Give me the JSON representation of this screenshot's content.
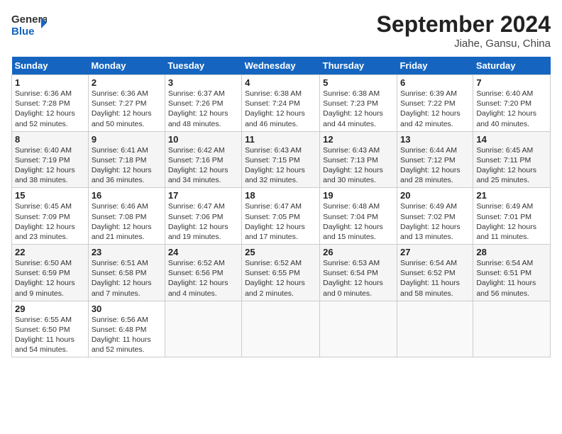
{
  "header": {
    "logo_general": "General",
    "logo_blue": "Blue",
    "month": "September 2024",
    "location": "Jiahe, Gansu, China"
  },
  "weekdays": [
    "Sunday",
    "Monday",
    "Tuesday",
    "Wednesday",
    "Thursday",
    "Friday",
    "Saturday"
  ],
  "weeks": [
    [
      {
        "day": "1",
        "info": "Sunrise: 6:36 AM\nSunset: 7:28 PM\nDaylight: 12 hours\nand 52 minutes."
      },
      {
        "day": "2",
        "info": "Sunrise: 6:36 AM\nSunset: 7:27 PM\nDaylight: 12 hours\nand 50 minutes."
      },
      {
        "day": "3",
        "info": "Sunrise: 6:37 AM\nSunset: 7:26 PM\nDaylight: 12 hours\nand 48 minutes."
      },
      {
        "day": "4",
        "info": "Sunrise: 6:38 AM\nSunset: 7:24 PM\nDaylight: 12 hours\nand 46 minutes."
      },
      {
        "day": "5",
        "info": "Sunrise: 6:38 AM\nSunset: 7:23 PM\nDaylight: 12 hours\nand 44 minutes."
      },
      {
        "day": "6",
        "info": "Sunrise: 6:39 AM\nSunset: 7:22 PM\nDaylight: 12 hours\nand 42 minutes."
      },
      {
        "day": "7",
        "info": "Sunrise: 6:40 AM\nSunset: 7:20 PM\nDaylight: 12 hours\nand 40 minutes."
      }
    ],
    [
      {
        "day": "8",
        "info": "Sunrise: 6:40 AM\nSunset: 7:19 PM\nDaylight: 12 hours\nand 38 minutes."
      },
      {
        "day": "9",
        "info": "Sunrise: 6:41 AM\nSunset: 7:18 PM\nDaylight: 12 hours\nand 36 minutes."
      },
      {
        "day": "10",
        "info": "Sunrise: 6:42 AM\nSunset: 7:16 PM\nDaylight: 12 hours\nand 34 minutes."
      },
      {
        "day": "11",
        "info": "Sunrise: 6:43 AM\nSunset: 7:15 PM\nDaylight: 12 hours\nand 32 minutes."
      },
      {
        "day": "12",
        "info": "Sunrise: 6:43 AM\nSunset: 7:13 PM\nDaylight: 12 hours\nand 30 minutes."
      },
      {
        "day": "13",
        "info": "Sunrise: 6:44 AM\nSunset: 7:12 PM\nDaylight: 12 hours\nand 28 minutes."
      },
      {
        "day": "14",
        "info": "Sunrise: 6:45 AM\nSunset: 7:11 PM\nDaylight: 12 hours\nand 25 minutes."
      }
    ],
    [
      {
        "day": "15",
        "info": "Sunrise: 6:45 AM\nSunset: 7:09 PM\nDaylight: 12 hours\nand 23 minutes."
      },
      {
        "day": "16",
        "info": "Sunrise: 6:46 AM\nSunset: 7:08 PM\nDaylight: 12 hours\nand 21 minutes."
      },
      {
        "day": "17",
        "info": "Sunrise: 6:47 AM\nSunset: 7:06 PM\nDaylight: 12 hours\nand 19 minutes."
      },
      {
        "day": "18",
        "info": "Sunrise: 6:47 AM\nSunset: 7:05 PM\nDaylight: 12 hours\nand 17 minutes."
      },
      {
        "day": "19",
        "info": "Sunrise: 6:48 AM\nSunset: 7:04 PM\nDaylight: 12 hours\nand 15 minutes."
      },
      {
        "day": "20",
        "info": "Sunrise: 6:49 AM\nSunset: 7:02 PM\nDaylight: 12 hours\nand 13 minutes."
      },
      {
        "day": "21",
        "info": "Sunrise: 6:49 AM\nSunset: 7:01 PM\nDaylight: 12 hours\nand 11 minutes."
      }
    ],
    [
      {
        "day": "22",
        "info": "Sunrise: 6:50 AM\nSunset: 6:59 PM\nDaylight: 12 hours\nand 9 minutes."
      },
      {
        "day": "23",
        "info": "Sunrise: 6:51 AM\nSunset: 6:58 PM\nDaylight: 12 hours\nand 7 minutes."
      },
      {
        "day": "24",
        "info": "Sunrise: 6:52 AM\nSunset: 6:56 PM\nDaylight: 12 hours\nand 4 minutes."
      },
      {
        "day": "25",
        "info": "Sunrise: 6:52 AM\nSunset: 6:55 PM\nDaylight: 12 hours\nand 2 minutes."
      },
      {
        "day": "26",
        "info": "Sunrise: 6:53 AM\nSunset: 6:54 PM\nDaylight: 12 hours\nand 0 minutes."
      },
      {
        "day": "27",
        "info": "Sunrise: 6:54 AM\nSunset: 6:52 PM\nDaylight: 11 hours\nand 58 minutes."
      },
      {
        "day": "28",
        "info": "Sunrise: 6:54 AM\nSunset: 6:51 PM\nDaylight: 11 hours\nand 56 minutes."
      }
    ],
    [
      {
        "day": "29",
        "info": "Sunrise: 6:55 AM\nSunset: 6:50 PM\nDaylight: 11 hours\nand 54 minutes."
      },
      {
        "day": "30",
        "info": "Sunrise: 6:56 AM\nSunset: 6:48 PM\nDaylight: 11 hours\nand 52 minutes."
      },
      {
        "day": "",
        "info": ""
      },
      {
        "day": "",
        "info": ""
      },
      {
        "day": "",
        "info": ""
      },
      {
        "day": "",
        "info": ""
      },
      {
        "day": "",
        "info": ""
      }
    ]
  ]
}
